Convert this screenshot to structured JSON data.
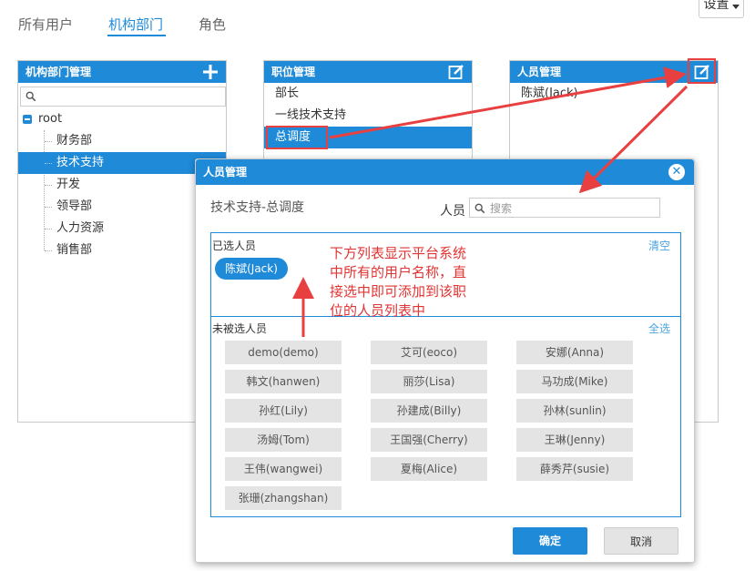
{
  "top_tabs": [
    {
      "label": "所有用户"
    },
    {
      "label": "机构部门"
    },
    {
      "label": "角色"
    }
  ],
  "settings_label": "设置",
  "org_panel": {
    "title": "机构部门管理",
    "root": "root",
    "nodes": [
      "财务部",
      "技术支持",
      "开发",
      "领导部",
      "人力资源",
      "销售部"
    ],
    "selected_index": 1
  },
  "position_panel": {
    "title": "职位管理",
    "items": [
      "部长",
      "一线技术支持",
      "总调度"
    ],
    "selected_index": 2
  },
  "person_panel": {
    "title": "人员管理",
    "items": [
      "陈斌(Jack)"
    ]
  },
  "dialog": {
    "title": "人员管理",
    "context": "技术支持-总调度",
    "search_label": "人员",
    "search_placeholder": "搜索",
    "selected_label": "已选人员",
    "clear_label": "清空",
    "selected_users": [
      "陈斌(Jack)"
    ],
    "unselected_label": "未被选人员",
    "select_all_label": "全选",
    "unselected_users": [
      "demo(demo)",
      "艾可(eoco)",
      "安娜(Anna)",
      "韩文(hanwen)",
      "丽莎(Lisa)",
      "马功成(Mike)",
      "孙红(Lily)",
      "孙建成(Billy)",
      "孙林(sunlin)",
      "汤姆(Tom)",
      "王国强(Cherry)",
      "王琳(Jenny)",
      "王伟(wangwei)",
      "夏梅(Alice)",
      "薛秀芹(susie)",
      "张珊(zhangshan)"
    ],
    "ok_label": "确定",
    "cancel_label": "取消"
  },
  "annotation": {
    "line1": "下方列表显示平台系统",
    "line2": "中所有的用户名称，直",
    "line3": "接选中即可添加到该职",
    "line4": "位的人员列表中"
  },
  "colors": {
    "accent": "#1f8ad8",
    "annotation_red": "#e13434"
  }
}
